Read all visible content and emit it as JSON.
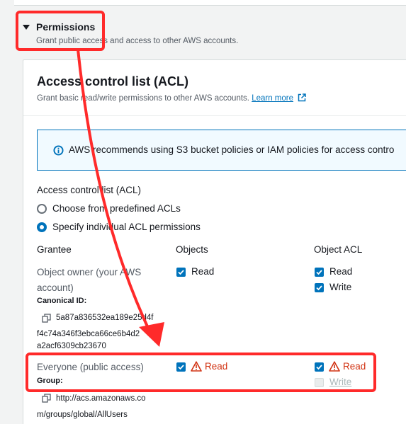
{
  "permissions": {
    "title": "Permissions",
    "description": "Grant public access and access to other AWS accounts."
  },
  "acl": {
    "title": "Access control list (ACL)",
    "description": "Grant basic read/write permissions to other AWS accounts.",
    "learn_more": "Learn more",
    "info_message": "AWS recommends using S3 bucket policies or IAM policies for access contro",
    "section_label": "Access control list (ACL)",
    "options": [
      {
        "label": "Choose from predefined ACLs",
        "selected": false
      },
      {
        "label": "Specify individual ACL permissions",
        "selected": true
      }
    ],
    "columns": {
      "grantee": "Grantee",
      "objects": "Objects",
      "object_acl": "Object ACL"
    },
    "owner": {
      "name_line1": "Object owner (your AWS",
      "name_line2": "account)",
      "id_label": "Canonical ID:",
      "id_line1": "5a87a836532ea189e25d4f",
      "id_line2": "f4c74a346f3ebca66ce6b4d2",
      "id_line3": "a2acf6309cb23670",
      "objects_read": "Read",
      "acl_read": "Read",
      "acl_write": "Write"
    },
    "everyone": {
      "name": "Everyone (public access)",
      "group_label": "Group:",
      "uri_line1": "http://acs.amazonaws.co",
      "uri_line2": "m/groups/global/AllUsers",
      "objects_read": "Read",
      "acl_read": "Read",
      "acl_write": "Write"
    }
  },
  "colors": {
    "accent": "#0073bb",
    "warning": "#d13212",
    "annotation": "#ff2a2a"
  },
  "icons": [
    "caret-down-icon",
    "external-link-icon",
    "info-icon",
    "copy-icon",
    "checkbox-checked-icon",
    "warning-icon"
  ]
}
